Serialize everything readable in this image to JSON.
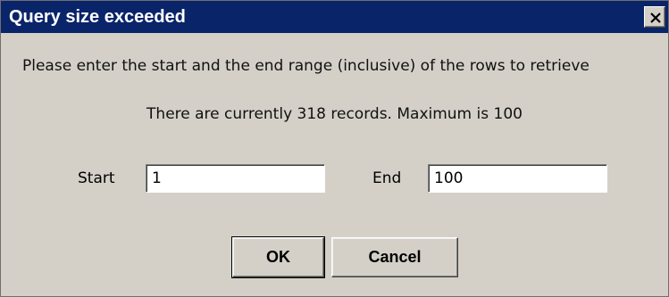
{
  "dialog": {
    "title": "Query size exceeded",
    "close_icon": "close-x-icon",
    "message_line_1": "Please enter the start and the end range (inclusive) of the rows to retrieve",
    "message_line_2": "There are currently 318 records. Maximum is 100",
    "start_label": "Start",
    "start_value": "1",
    "end_label": "End",
    "end_value": "100",
    "ok_label": "OK",
    "cancel_label": "Cancel"
  },
  "colors": {
    "titlebar": "#0a246a",
    "window_bg": "#d4d0c8",
    "title_text": "#ffffff"
  }
}
